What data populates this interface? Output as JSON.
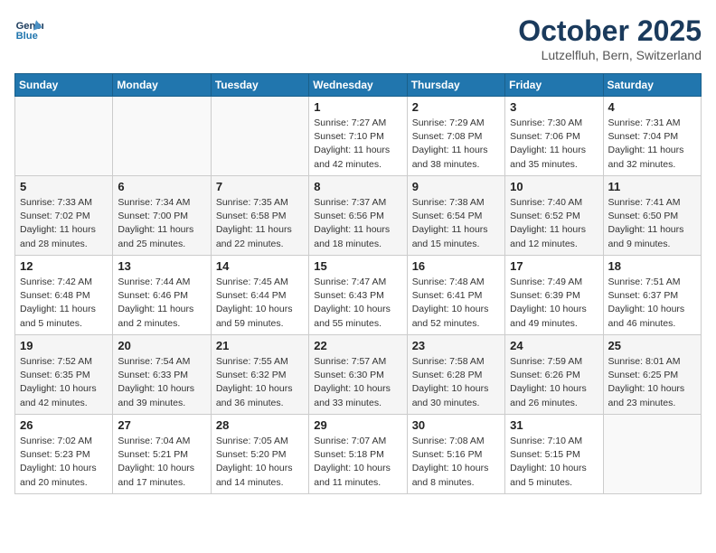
{
  "header": {
    "logo_line1": "General",
    "logo_line2": "Blue",
    "month": "October 2025",
    "location": "Lutzelfluh, Bern, Switzerland"
  },
  "weekdays": [
    "Sunday",
    "Monday",
    "Tuesday",
    "Wednesday",
    "Thursday",
    "Friday",
    "Saturday"
  ],
  "weeks": [
    [
      {
        "day": "",
        "info": ""
      },
      {
        "day": "",
        "info": ""
      },
      {
        "day": "",
        "info": ""
      },
      {
        "day": "1",
        "info": "Sunrise: 7:27 AM\nSunset: 7:10 PM\nDaylight: 11 hours\nand 42 minutes."
      },
      {
        "day": "2",
        "info": "Sunrise: 7:29 AM\nSunset: 7:08 PM\nDaylight: 11 hours\nand 38 minutes."
      },
      {
        "day": "3",
        "info": "Sunrise: 7:30 AM\nSunset: 7:06 PM\nDaylight: 11 hours\nand 35 minutes."
      },
      {
        "day": "4",
        "info": "Sunrise: 7:31 AM\nSunset: 7:04 PM\nDaylight: 11 hours\nand 32 minutes."
      }
    ],
    [
      {
        "day": "5",
        "info": "Sunrise: 7:33 AM\nSunset: 7:02 PM\nDaylight: 11 hours\nand 28 minutes."
      },
      {
        "day": "6",
        "info": "Sunrise: 7:34 AM\nSunset: 7:00 PM\nDaylight: 11 hours\nand 25 minutes."
      },
      {
        "day": "7",
        "info": "Sunrise: 7:35 AM\nSunset: 6:58 PM\nDaylight: 11 hours\nand 22 minutes."
      },
      {
        "day": "8",
        "info": "Sunrise: 7:37 AM\nSunset: 6:56 PM\nDaylight: 11 hours\nand 18 minutes."
      },
      {
        "day": "9",
        "info": "Sunrise: 7:38 AM\nSunset: 6:54 PM\nDaylight: 11 hours\nand 15 minutes."
      },
      {
        "day": "10",
        "info": "Sunrise: 7:40 AM\nSunset: 6:52 PM\nDaylight: 11 hours\nand 12 minutes."
      },
      {
        "day": "11",
        "info": "Sunrise: 7:41 AM\nSunset: 6:50 PM\nDaylight: 11 hours\nand 9 minutes."
      }
    ],
    [
      {
        "day": "12",
        "info": "Sunrise: 7:42 AM\nSunset: 6:48 PM\nDaylight: 11 hours\nand 5 minutes."
      },
      {
        "day": "13",
        "info": "Sunrise: 7:44 AM\nSunset: 6:46 PM\nDaylight: 11 hours\nand 2 minutes."
      },
      {
        "day": "14",
        "info": "Sunrise: 7:45 AM\nSunset: 6:44 PM\nDaylight: 10 hours\nand 59 minutes."
      },
      {
        "day": "15",
        "info": "Sunrise: 7:47 AM\nSunset: 6:43 PM\nDaylight: 10 hours\nand 55 minutes."
      },
      {
        "day": "16",
        "info": "Sunrise: 7:48 AM\nSunset: 6:41 PM\nDaylight: 10 hours\nand 52 minutes."
      },
      {
        "day": "17",
        "info": "Sunrise: 7:49 AM\nSunset: 6:39 PM\nDaylight: 10 hours\nand 49 minutes."
      },
      {
        "day": "18",
        "info": "Sunrise: 7:51 AM\nSunset: 6:37 PM\nDaylight: 10 hours\nand 46 minutes."
      }
    ],
    [
      {
        "day": "19",
        "info": "Sunrise: 7:52 AM\nSunset: 6:35 PM\nDaylight: 10 hours\nand 42 minutes."
      },
      {
        "day": "20",
        "info": "Sunrise: 7:54 AM\nSunset: 6:33 PM\nDaylight: 10 hours\nand 39 minutes."
      },
      {
        "day": "21",
        "info": "Sunrise: 7:55 AM\nSunset: 6:32 PM\nDaylight: 10 hours\nand 36 minutes."
      },
      {
        "day": "22",
        "info": "Sunrise: 7:57 AM\nSunset: 6:30 PM\nDaylight: 10 hours\nand 33 minutes."
      },
      {
        "day": "23",
        "info": "Sunrise: 7:58 AM\nSunset: 6:28 PM\nDaylight: 10 hours\nand 30 minutes."
      },
      {
        "day": "24",
        "info": "Sunrise: 7:59 AM\nSunset: 6:26 PM\nDaylight: 10 hours\nand 26 minutes."
      },
      {
        "day": "25",
        "info": "Sunrise: 8:01 AM\nSunset: 6:25 PM\nDaylight: 10 hours\nand 23 minutes."
      }
    ],
    [
      {
        "day": "26",
        "info": "Sunrise: 7:02 AM\nSunset: 5:23 PM\nDaylight: 10 hours\nand 20 minutes."
      },
      {
        "day": "27",
        "info": "Sunrise: 7:04 AM\nSunset: 5:21 PM\nDaylight: 10 hours\nand 17 minutes."
      },
      {
        "day": "28",
        "info": "Sunrise: 7:05 AM\nSunset: 5:20 PM\nDaylight: 10 hours\nand 14 minutes."
      },
      {
        "day": "29",
        "info": "Sunrise: 7:07 AM\nSunset: 5:18 PM\nDaylight: 10 hours\nand 11 minutes."
      },
      {
        "day": "30",
        "info": "Sunrise: 7:08 AM\nSunset: 5:16 PM\nDaylight: 10 hours\nand 8 minutes."
      },
      {
        "day": "31",
        "info": "Sunrise: 7:10 AM\nSunset: 5:15 PM\nDaylight: 10 hours\nand 5 minutes."
      },
      {
        "day": "",
        "info": ""
      }
    ]
  ]
}
